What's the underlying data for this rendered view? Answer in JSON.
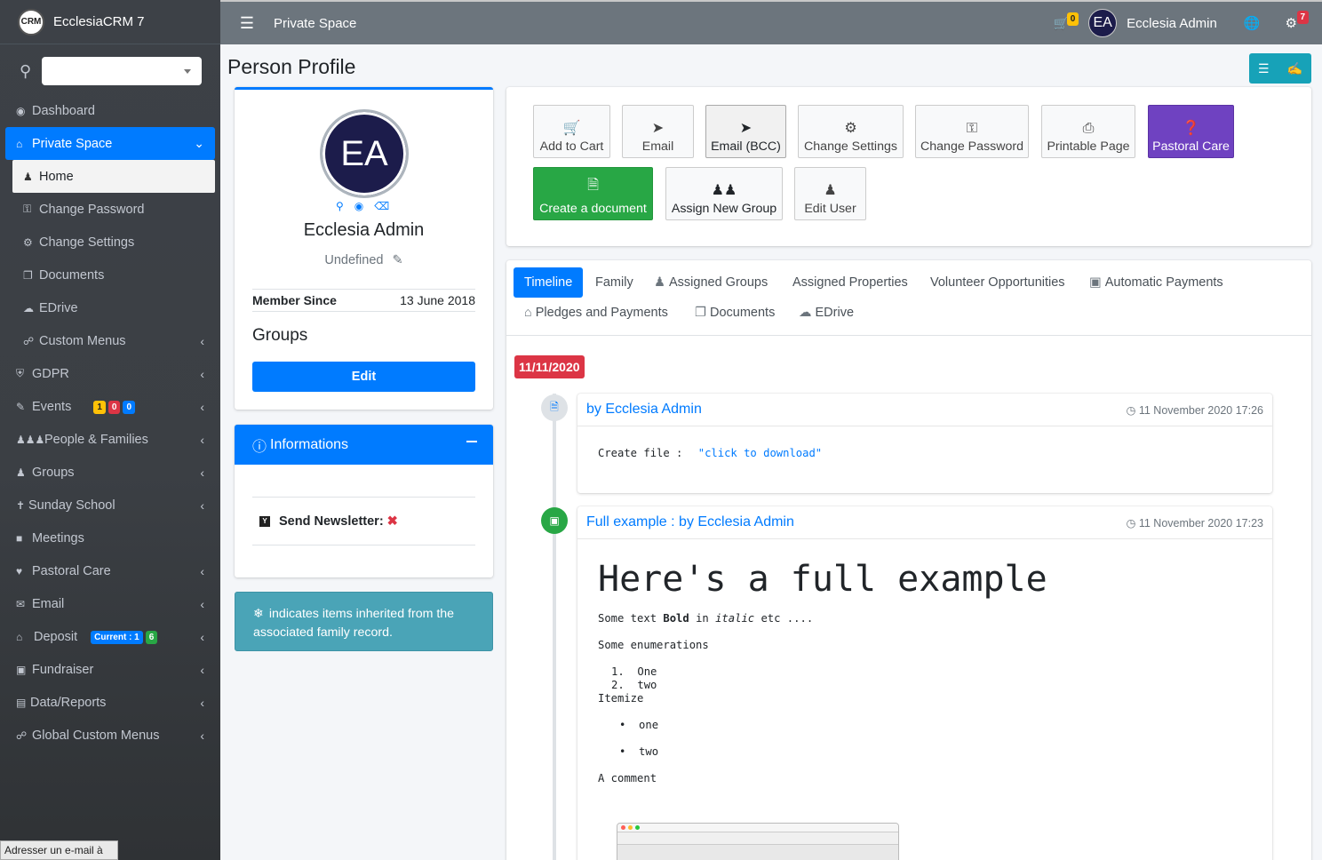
{
  "app": {
    "logo": "CRM",
    "name": "EcclesiaCRM 7"
  },
  "sidebar": {
    "items": [
      {
        "label": "Dashboard"
      },
      {
        "label": "Private Space"
      },
      {
        "label": "Home"
      },
      {
        "label": "Change Password"
      },
      {
        "label": "Change Settings"
      },
      {
        "label": "Documents"
      },
      {
        "label": "EDrive"
      },
      {
        "label": "Custom Menus"
      },
      {
        "label": "GDPR"
      },
      {
        "label": "Events",
        "badges": [
          "1",
          "0",
          "0"
        ]
      },
      {
        "label": "People & Families"
      },
      {
        "label": "Groups"
      },
      {
        "label": "Sunday School"
      },
      {
        "label": "Meetings"
      },
      {
        "label": "Pastoral Care"
      },
      {
        "label": "Email"
      },
      {
        "label": "Deposit",
        "badges": [
          "Current : 1",
          "6"
        ]
      },
      {
        "label": "Fundraiser"
      },
      {
        "label": "Data/Reports"
      },
      {
        "label": "Global Custom Menus"
      }
    ],
    "tooltip": "Adresser un e-mail à"
  },
  "topbar": {
    "title": "Private Space",
    "cart_count": "0",
    "user_initials": "EA",
    "user_name": "Ecclesia Admin",
    "notif_count": "7"
  },
  "page": {
    "title": "Person Profile"
  },
  "profile": {
    "initials": "EA",
    "name": "Ecclesia Admin",
    "role": "Undefined",
    "member_since_label": "Member Since",
    "member_since_value": "13 June 2018",
    "groups_heading": "Groups",
    "edit_label": "Edit"
  },
  "informations": {
    "title": "Informations",
    "newsletter_label": "Send Newsletter:",
    "newsletter_flag": "Y",
    "newsletter_value": "✖"
  },
  "callout": {
    "text": "indicates items inherited from the associated family record."
  },
  "actions": [
    {
      "label": "Add to Cart",
      "icon": "cart-plus-icon"
    },
    {
      "label": "Email",
      "icon": "paper-plane-icon"
    },
    {
      "label": "Email (BCC)",
      "icon": "paper-plane-icon"
    },
    {
      "label": "Change Settings",
      "icon": "gear-icon"
    },
    {
      "label": "Change Password",
      "icon": "key-icon"
    },
    {
      "label": "Printable Page",
      "icon": "print-icon"
    },
    {
      "label": "Pastoral Care",
      "icon": "question-icon"
    },
    {
      "label": "Create a document",
      "icon": "file-icon"
    },
    {
      "label": "Assign New Group",
      "icon": "users-icon"
    },
    {
      "label": "Edit User",
      "icon": "user-secret-icon"
    }
  ],
  "tabs": [
    {
      "label": "Timeline"
    },
    {
      "label": "Family"
    },
    {
      "label": "Assigned Groups"
    },
    {
      "label": "Assigned Properties"
    },
    {
      "label": "Volunteer Opportunities"
    },
    {
      "label": "Automatic Payments"
    },
    {
      "label": "Pledges and Payments"
    },
    {
      "label": "Documents"
    },
    {
      "label": "EDrive"
    }
  ],
  "timeline": {
    "date": "11/11/2020",
    "items": [
      {
        "who": "by Ecclesia Admin",
        "time": "11 November 2020 17:26",
        "body_prefix": "Create file :",
        "body_link": "\"click to download\""
      },
      {
        "who": "Full example : by Ecclesia Admin",
        "time": "11 November 2020 17:23",
        "heading": "Here's a full example",
        "line1_a": "Some text ",
        "line1_b": "Bold",
        "line1_c": " in ",
        "line1_d": "italic",
        "line1_e": " etc ....",
        "enum_label": "Some enumerations",
        "enum": [
          "One",
          "two"
        ],
        "itemize_label": "Itemize",
        "itemize": [
          "one",
          "two"
        ],
        "comment": "A comment"
      }
    ]
  },
  "colors": {
    "primary": "#007bff",
    "sidebar": "#3b3f44",
    "topbar": "#6c757d",
    "purple": "#6f42c1",
    "green": "#28a745",
    "danger": "#dc3545",
    "info": "#4aa4b7"
  }
}
